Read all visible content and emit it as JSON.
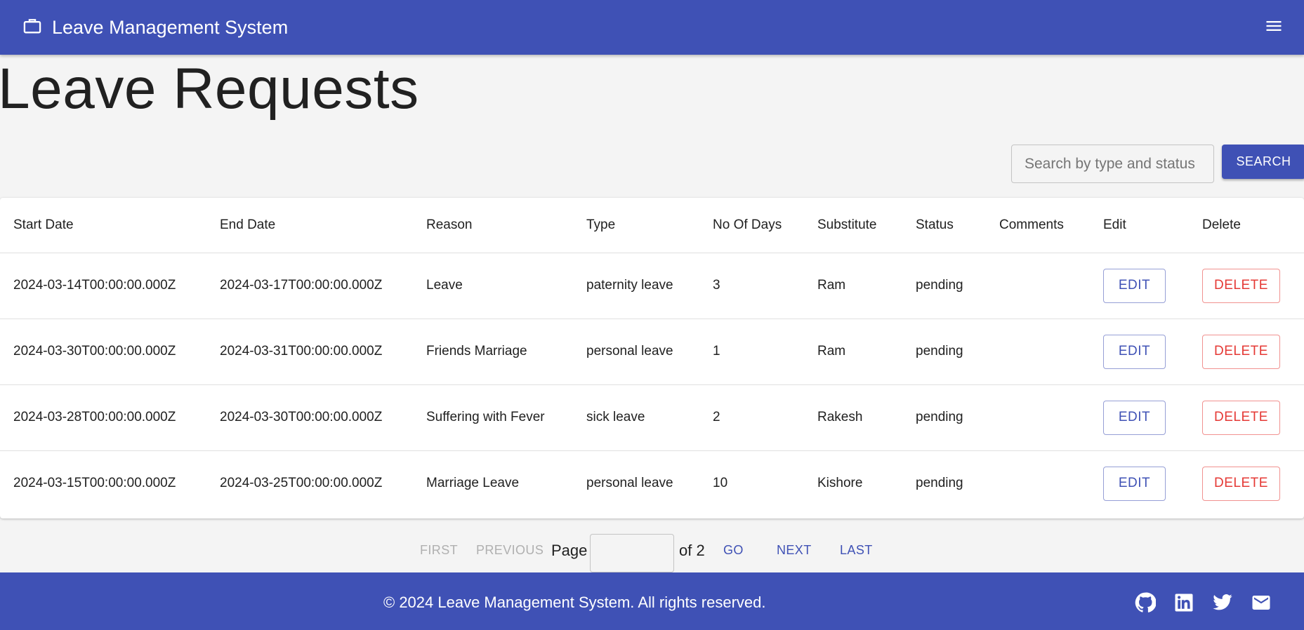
{
  "app": {
    "title": "Leave Management System",
    "brand_icon": "briefcase-icon",
    "menu_icon": "menu-icon",
    "accent_color": "#3f51b5",
    "delete_color": "#e53935"
  },
  "page": {
    "title": "Leave Requests"
  },
  "search": {
    "placeholder": "Search by type and status",
    "value": "",
    "button_label": "SEARCH"
  },
  "table": {
    "headers": [
      "Start Date",
      "End Date",
      "Reason",
      "Type",
      "No Of Days",
      "Substitute",
      "Status",
      "Comments",
      "Edit",
      "Delete"
    ],
    "rows": [
      {
        "start": "2024-03-14T00:00:00.000Z",
        "end": "2024-03-17T00:00:00.000Z",
        "reason": "Leave",
        "type": "paternity leave",
        "days": "3",
        "substitute": "Ram",
        "status": "pending",
        "comments": "",
        "edit": "EDIT",
        "delete": "DELETE"
      },
      {
        "start": "2024-03-30T00:00:00.000Z",
        "end": "2024-03-31T00:00:00.000Z",
        "reason": "Friends Marriage",
        "type": "personal leave",
        "days": "1",
        "substitute": "Ram",
        "status": "pending",
        "comments": "",
        "edit": "EDIT",
        "delete": "DELETE"
      },
      {
        "start": "2024-03-28T00:00:00.000Z",
        "end": "2024-03-30T00:00:00.000Z",
        "reason": "Suffering with Fever",
        "type": "sick leave",
        "days": "2",
        "substitute": "Rakesh",
        "status": "pending",
        "comments": "",
        "edit": "EDIT",
        "delete": "DELETE"
      },
      {
        "start": "2024-03-15T00:00:00.000Z",
        "end": "2024-03-25T00:00:00.000Z",
        "reason": "Marriage Leave",
        "type": "personal leave",
        "days": "10",
        "substitute": "Kishore",
        "status": "pending",
        "comments": "",
        "edit": "EDIT",
        "delete": "DELETE"
      }
    ]
  },
  "pagination": {
    "first": "FIRST",
    "previous": "PREVIOUS",
    "page_label": "Page",
    "page_value": "",
    "of_label": "of 2",
    "go": "GO",
    "next": "NEXT",
    "last": "LAST"
  },
  "footer": {
    "text": "© 2024 Leave Management System. All rights reserved.",
    "icons": [
      "github-icon",
      "linkedin-icon",
      "twitter-icon",
      "email-icon"
    ]
  }
}
